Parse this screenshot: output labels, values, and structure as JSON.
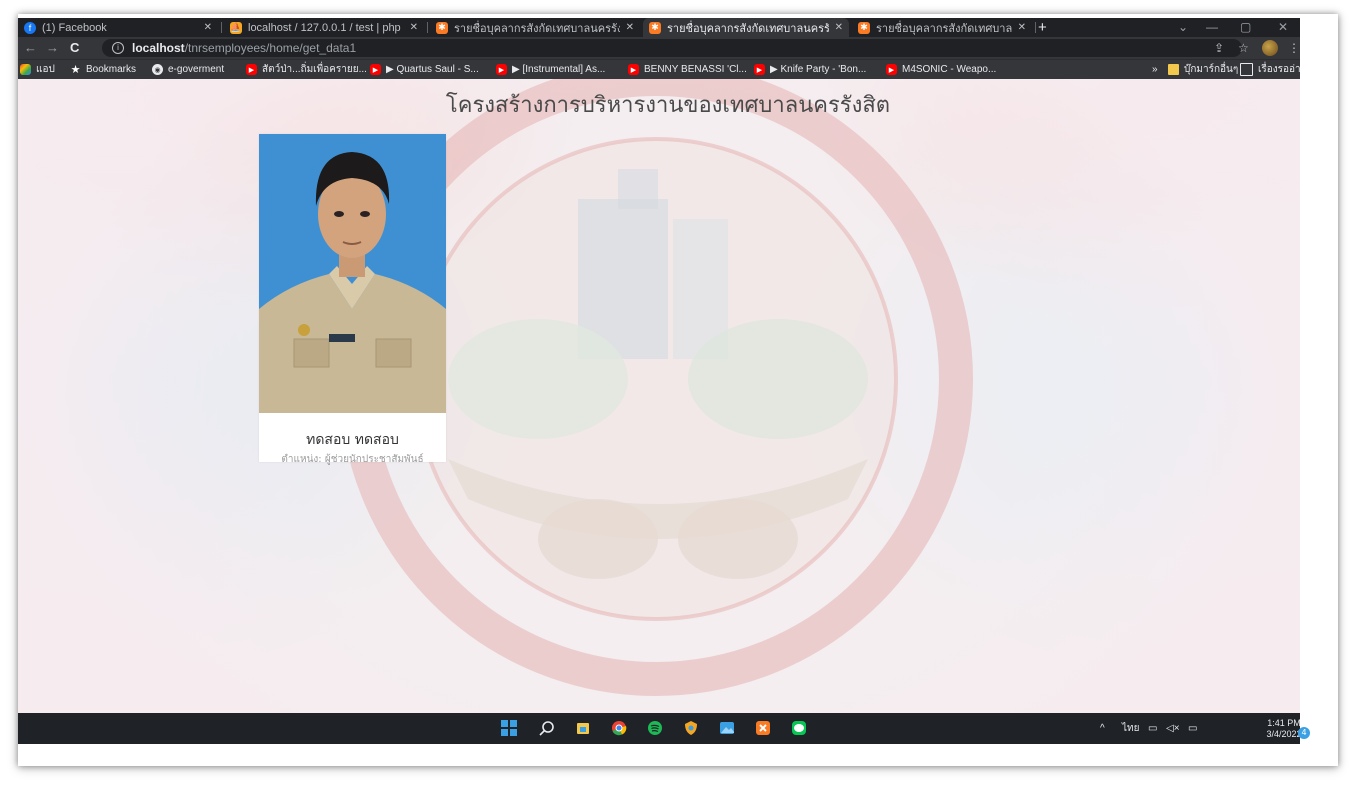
{
  "tabs": [
    {
      "label": "(1) Facebook",
      "icon": "facebook-icon",
      "color": "#1877f2",
      "active": false
    },
    {
      "label": "localhost / 127.0.0.1 / test | php",
      "icon": "phpmyadmin-icon",
      "color": "#f5a623",
      "active": false
    },
    {
      "label": "รายชื่อบุคลากรสังกัดเทศบาลนครรังสิต",
      "icon": "xampp-icon",
      "color": "#fb7a24",
      "active": false
    },
    {
      "label": "รายชื่อบุคลากรสังกัดเทศบาลนครรังสิต",
      "icon": "xampp-icon",
      "color": "#fb7a24",
      "active": true
    },
    {
      "label": "รายชื่อบุคลากรสังกัดเทศบาลนครรังสิต",
      "icon": "xampp-icon",
      "color": "#fb7a24",
      "active": false
    }
  ],
  "toolbar": {
    "url_host": "localhost",
    "url_path": "/tnrsemployees/home/get_data1"
  },
  "bookmarks": [
    {
      "label": "แอป",
      "icon": "apps-grid-icon",
      "color": "#ea4335"
    },
    {
      "label": "Bookmarks",
      "icon": "star-icon",
      "color": "#ffffff"
    },
    {
      "label": "e-goverment",
      "icon": "globe-icon",
      "color": "#e8eaed"
    },
    {
      "label": "สัตว์ป่า...ถิ่มเพื่อครายย...",
      "icon": "youtube-icon",
      "color": "#ff0000"
    },
    {
      "label": "▶ Quartus Saul - S...",
      "icon": "youtube-icon",
      "color": "#ff0000"
    },
    {
      "label": "▶ [Instrumental] As...",
      "icon": "youtube-icon",
      "color": "#ff0000"
    },
    {
      "label": "BENNY BENASSI 'Cl...",
      "icon": "youtube-icon",
      "color": "#ff0000"
    },
    {
      "label": "▶ Knife Party - 'Bon...",
      "icon": "youtube-icon",
      "color": "#ff0000"
    },
    {
      "label": "M4SONIC - Weapo...",
      "icon": "youtube-icon",
      "color": "#ff0000"
    }
  ],
  "bookmarks_right": {
    "more": "»",
    "folder_label": "บุ๊กมาร์กอื่นๆ",
    "reading_list_label": "เรื่องรออ่าน"
  },
  "page": {
    "title": "โครงสร้างการบริหารงานของเทศบาลนครรังสิต",
    "employee": {
      "name": "ทดสอบ ทดสอบ",
      "position": "ตำแหน่ง: ผู้ช่วยนักประชาสัมพันธ์"
    }
  },
  "taskbar": {
    "lang": "ไทย",
    "time": "1:41 PM",
    "date": "3/4/2022",
    "notifications": "4"
  }
}
